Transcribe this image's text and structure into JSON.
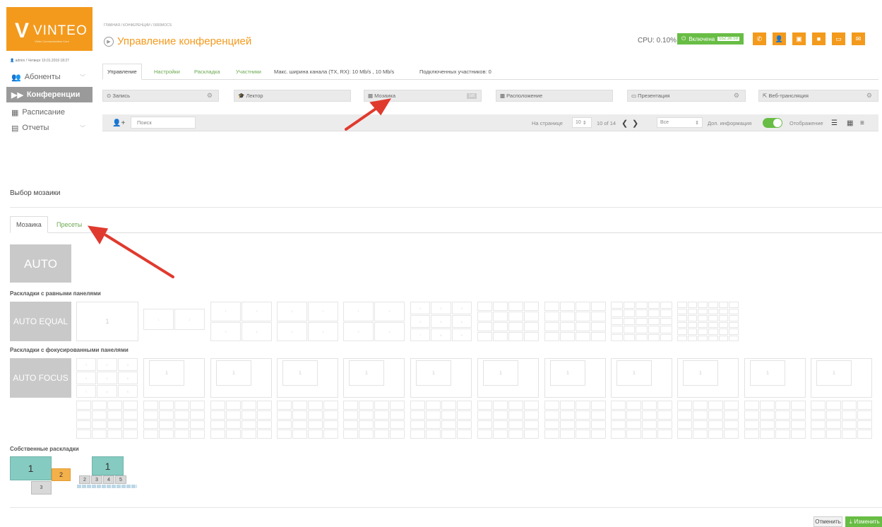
{
  "logo": {
    "text": "VINTEO",
    "subtitle": "Video Communication Core"
  },
  "sidebar": {
    "user": "admin / Четверг 10.01.2019 18:27",
    "items": [
      {
        "label": "Абоненты",
        "icon": "users-icon"
      },
      {
        "label": "Конференции",
        "icon": "forward-icon"
      },
      {
        "label": "Расписание",
        "icon": "calendar-icon"
      },
      {
        "label": "Отчеты",
        "icon": "book-icon"
      }
    ]
  },
  "header": {
    "breadcrumb": "ГЛАВНАЯ / КОНФЕРЕНЦИИ / 0000MOCS",
    "title": "Управление конференцией",
    "cpu": "CPU: 0.10%",
    "status_label": "Включена",
    "status_time": "552:36:59"
  },
  "tabs": [
    "Управление",
    "Настройки",
    "Раскладка",
    "Участники"
  ],
  "tabs_info": {
    "bandwidth": "Макс. ширина канала (TX, RX): 10 Mb/s , 10 Mb/s",
    "connected": "Подключенных участников: 0"
  },
  "toolbar": {
    "record": "Запись",
    "lector": "Лектор",
    "mosaic": "Мозаика",
    "mosaic_badge": "1x5",
    "layout": "Расположение",
    "presentation": "Презентация",
    "webcast": "Веб-трансляция"
  },
  "filter": {
    "search_placeholder": "Поиск",
    "per_page_label": "На странице",
    "per_page": "10",
    "range": "10 of 14",
    "scope": "Все",
    "extra_info": "Доп. информация",
    "display": "Отображение"
  },
  "mosaic": {
    "section_title": "Выбор мозаики",
    "tab_active": "Мозаика",
    "tab_presets": "Пресеты",
    "auto": "AUTO",
    "equal_title": "Раскладки с равными панелями",
    "auto_equal": "AUTO EQUAL",
    "focus_title": "Раскладки с фокусированными панелями",
    "auto_focus": "AUTO FOCUS",
    "custom_title": "Собственные раскладки"
  },
  "footer": {
    "cancel": "Отменить",
    "apply": "Изменить"
  },
  "colors": {
    "orange": "#f39a1d",
    "green": "#68bd45",
    "teal": "#86cbc1",
    "arrow": "#e03a2e"
  }
}
